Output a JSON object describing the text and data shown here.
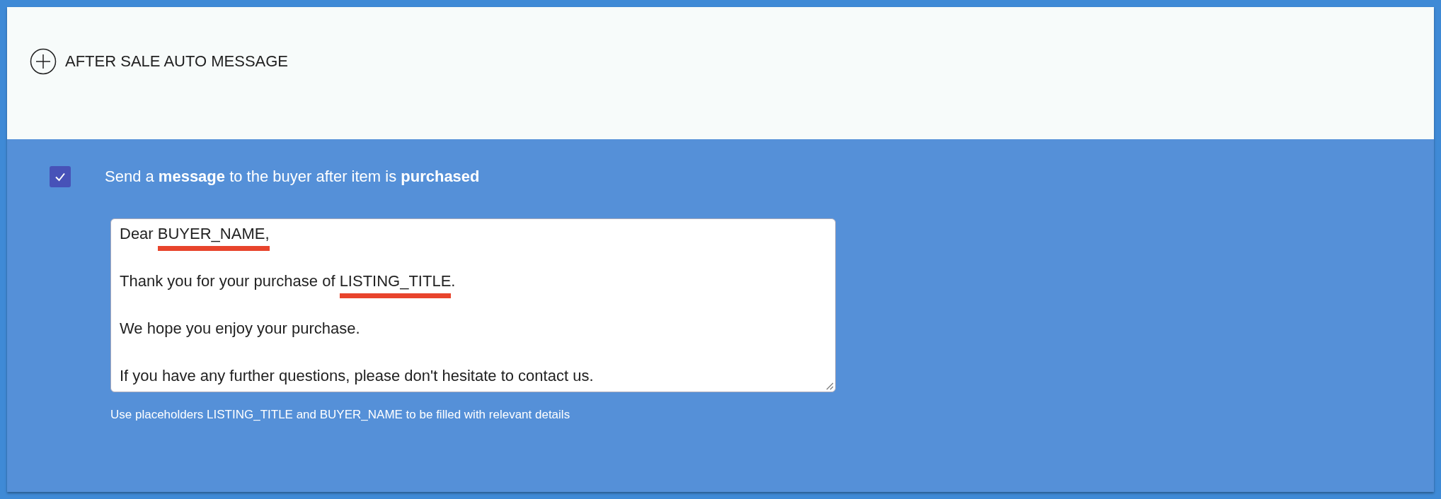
{
  "section": {
    "title": "AFTER SALE AUTO MESSAGE",
    "expanded": false
  },
  "option": {
    "checked": true,
    "label": "Send a **message** to the buyer after item is **purchased**"
  },
  "message_field": {
    "paragraphs": [
      [
        {
          "text": "Dear "
        },
        {
          "text": "BUYER_NAME,",
          "marked": true
        }
      ],
      [
        {
          "text": "Thank you for your purchase of "
        },
        {
          "text": "LISTING_TITLE",
          "marked": true
        },
        {
          "text": "."
        }
      ],
      [
        {
          "text": "We hope you enjoy your purchase."
        }
      ],
      [
        {
          "text": "If you have any further questions, please don't hesitate to contact us."
        }
      ]
    ]
  },
  "hint": "Use placeholders LISTING_TITLE and BUYER_NAME to be filled with relevant details"
}
